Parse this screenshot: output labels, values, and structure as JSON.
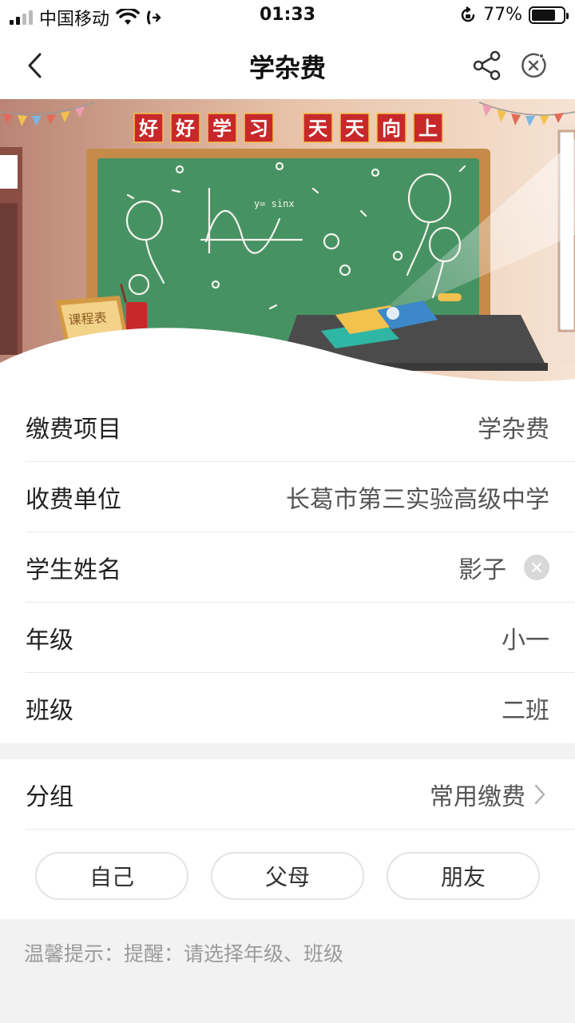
{
  "status_bar": {
    "carrier": "中国移动",
    "time": "01:33",
    "battery_percent": "77%",
    "battery_level": 0.77
  },
  "nav": {
    "title": "学杂费",
    "back_icon": "back-chevron-icon",
    "share_icon": "share-icon",
    "close_icon": "close-mini-program-icon"
  },
  "banner": {
    "slogan_chars": [
      "好",
      "好",
      "学",
      "习",
      "天",
      "天",
      "向",
      "上"
    ],
    "board_formula": "y= sinx",
    "schedule_label": "课程表"
  },
  "form": {
    "rows": [
      {
        "label": "缴费项目",
        "value": "学杂费"
      },
      {
        "label": "收费单位",
        "value": "长葛市第三实验高级中学"
      },
      {
        "label": "学生姓名",
        "value": "影子"
      },
      {
        "label": "年级",
        "value": "小一"
      },
      {
        "label": "班级",
        "value": "二班"
      }
    ]
  },
  "group": {
    "label": "分组",
    "value": "常用缴费",
    "options": [
      "自己",
      "父母",
      "朋友"
    ]
  },
  "tip": "温馨提示：提醒：请选择年级、班级",
  "colors": {
    "accent_red": "#c8282a",
    "chalkboard": "#3f8a5c",
    "frame": "#c68a4a"
  }
}
